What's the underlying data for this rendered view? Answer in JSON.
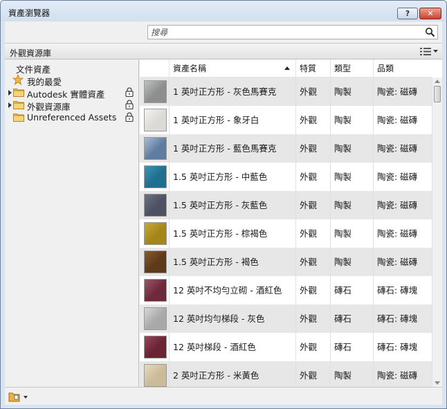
{
  "window": {
    "title": "資產瀏覽器",
    "help_label": "?",
    "close_label": "✕"
  },
  "search": {
    "placeholder": "搜尋",
    "value": ""
  },
  "section": {
    "title": "外觀資源庫"
  },
  "tree": [
    {
      "label": "文件資產",
      "icon": "none",
      "expander": false,
      "locked": false
    },
    {
      "label": "我的最愛",
      "icon": "star-icon",
      "expander": false,
      "locked": false
    },
    {
      "label": "Autodesk 實體資產",
      "icon": "folder-icon",
      "expander": true,
      "locked": true
    },
    {
      "label": "外觀資源庫",
      "icon": "folder-icon",
      "expander": true,
      "locked": true
    },
    {
      "label": "Unreferenced Assets",
      "icon": "folder-icon",
      "expander": false,
      "locked": true
    }
  ],
  "table": {
    "columns": [
      "資產名稱",
      "特質",
      "類型",
      "品類"
    ],
    "sorted_column": "資產名稱",
    "rows": [
      {
        "name": "1 英吋正方形 - 灰色馬賽克",
        "property": "外觀",
        "type": "陶製",
        "category": "陶瓷: 磁磚",
        "swatch": "#8d8f8f",
        "swatch2": "#bfc1c1"
      },
      {
        "name": "1 英吋正方形 - 象牙白",
        "property": "外觀",
        "type": "陶製",
        "category": "陶瓷: 磁磚",
        "swatch": "#dcdad6",
        "swatch2": "#f4f3f0"
      },
      {
        "name": "1 英吋正方形 - 藍色馬賽克",
        "property": "外觀",
        "type": "陶製",
        "category": "陶瓷: 磁磚",
        "swatch": "#5f7da0",
        "swatch2": "#a9bdd4"
      },
      {
        "name": "1.5 英吋正方形 - 中藍色",
        "property": "外觀",
        "type": "陶製",
        "category": "陶瓷: 磁磚",
        "swatch": "#1f6f8f",
        "swatch2": "#3e95b6"
      },
      {
        "name": "1.5 英吋正方形 - 灰藍色",
        "property": "外觀",
        "type": "陶製",
        "category": "陶瓷: 磁磚",
        "swatch": "#4d5163",
        "swatch2": "#6c7185"
      },
      {
        "name": "1.5 英吋正方形 - 棕褐色",
        "property": "外觀",
        "type": "陶製",
        "category": "陶瓷: 磁磚",
        "swatch": "#a5861b",
        "swatch2": "#c8a93a"
      },
      {
        "name": "1.5 英吋正方形 - 褐色",
        "property": "外觀",
        "type": "陶製",
        "category": "陶瓷: 磁磚",
        "swatch": "#5e3a1a",
        "swatch2": "#875a30"
      },
      {
        "name": "12 英吋不均勻立砌 - 酒紅色",
        "property": "外觀",
        "type": "磚石",
        "category": "磚石: 磚塊",
        "swatch": "#6e2a3a",
        "swatch2": "#9a5666"
      },
      {
        "name": "12 英吋均勻梯段 - 灰色",
        "property": "外觀",
        "type": "磚石",
        "category": "磚石: 磚塊",
        "swatch": "#a9a9a9",
        "swatch2": "#d7d7d7"
      },
      {
        "name": "12 英吋梯段 - 酒紅色",
        "property": "外觀",
        "type": "磚石",
        "category": "磚石: 磚塊",
        "swatch": "#6a2333",
        "swatch2": "#94495a"
      },
      {
        "name": "2 英吋正方形 - 米黃色",
        "property": "外觀",
        "type": "陶製",
        "category": "陶瓷: 磁磚",
        "swatch": "#cbbb98",
        "swatch2": "#e6dac0"
      }
    ]
  }
}
